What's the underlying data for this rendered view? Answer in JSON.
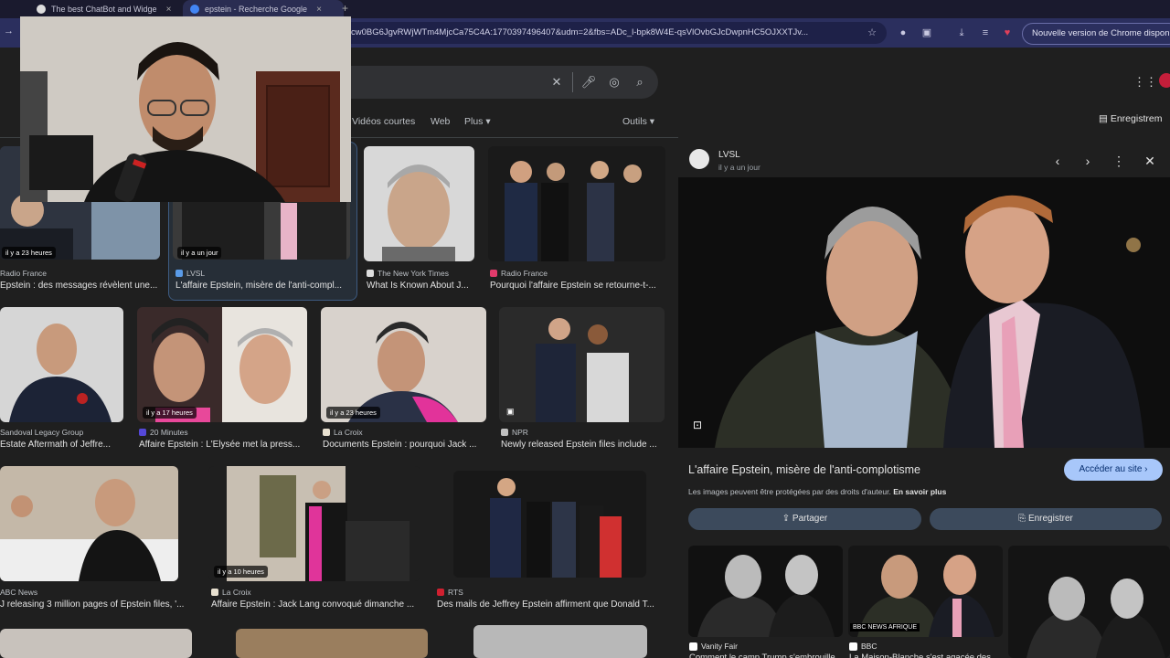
{
  "browser": {
    "tabs": [
      {
        "title": "The best ChatBot and Widge",
        "close": "×"
      },
      {
        "title": "epstein - Recherche Google",
        "close": "×"
      }
    ],
    "new_tab": "+",
    "url": "cw0BG6JgvRWjWTm4MjcCa75C4A:1770397496407&udm=2&fbs=ADc_l-bpk8W4E-qsVlOvbGJcDwpnHC5OJXXTJv...",
    "update_label": "Nouvelle version de Chrome dispon"
  },
  "google": {
    "nav_tabs": [
      "Vidéos courtes",
      "Web",
      "Plus ▾"
    ],
    "tools": "Outils ▾",
    "save_label": "Enregistrem"
  },
  "results": [
    {
      "source": "Radio France",
      "title": "Epstein : des messages révèlent une...",
      "badge": "il y a 23 heures"
    },
    {
      "source": "LVSL",
      "title": "L'affaire Epstein, misère de l'anti-compl...",
      "badge": "il y a un jour"
    },
    {
      "source": "The New York Times",
      "title": "What Is Known About J...",
      "badge": ""
    },
    {
      "source": "Radio France",
      "title": "Pourquoi l'affaire Epstein se retourne-t-...",
      "badge": ""
    },
    {
      "source": "Sandoval Legacy Group",
      "title": "Estate Aftermath of Jeffre...",
      "badge": ""
    },
    {
      "source": "20 Minutes",
      "title": "Affaire Epstein : L'Elysée met la press...",
      "badge": "il y a 17 heures"
    },
    {
      "source": "La Croix",
      "title": "Documents Epstein : pourquoi Jack ...",
      "badge": "il y a 23 heures"
    },
    {
      "source": "NPR",
      "title": "Newly released Epstein files include ...",
      "badge": ""
    },
    {
      "source": "ABC News",
      "title": "J releasing 3 million pages of Epstein files, '...",
      "badge": ""
    },
    {
      "source": "La Croix",
      "title": "Affaire Epstein : Jack Lang convoqué dimanche ...",
      "badge": "il y a 10 heures"
    },
    {
      "source": "RTS",
      "title": "Des mails de Jeffrey Epstein affirment que Donald T...",
      "badge": ""
    }
  ],
  "panel": {
    "source": "LVSL",
    "time": "il y a un jour",
    "title": "L'affaire Epstein, misère de l'anti-complotisme",
    "visit": "Accéder au site ›",
    "copyright": "Les images peuvent être protégées par des droits d'auteur.",
    "learn_more": "En savoir plus",
    "share": "Partager",
    "save": "Enregistrer",
    "related": [
      {
        "source": "Vanity Fair",
        "title": "Comment le camp Trump s'embrouille..."
      },
      {
        "source": "BBC",
        "title": "La Maison-Blanche s'est agacée des..."
      }
    ]
  },
  "colors": {
    "accent": "#a8c7fa",
    "bg": "#1f1f1f",
    "browser": "#2b2f5e"
  }
}
